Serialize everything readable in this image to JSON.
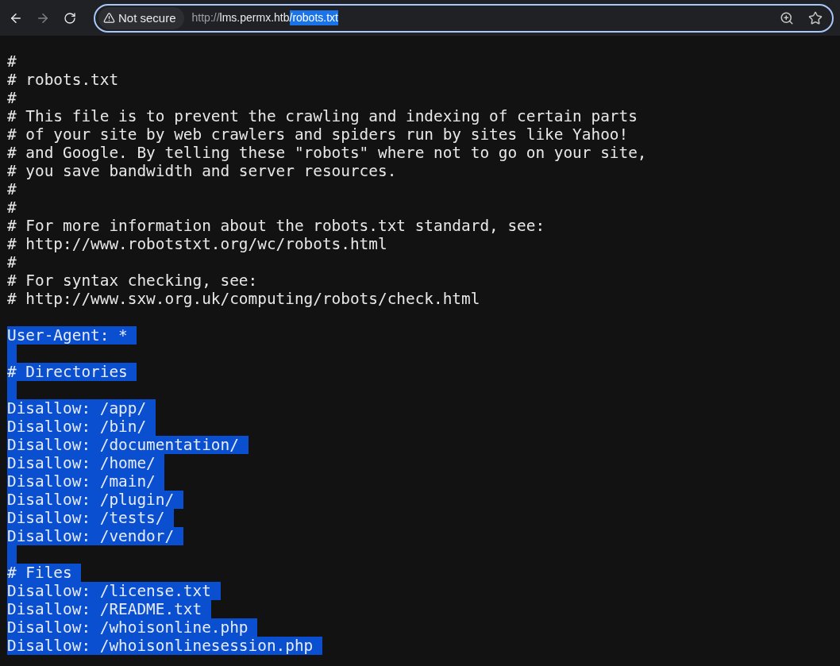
{
  "toolbar": {
    "back_enabled": true,
    "forward_enabled": false
  },
  "address_bar": {
    "security_label": "Not secure",
    "scheme": "http://",
    "host": "lms.permx.htb",
    "path": "/robots.txt",
    "path_selected": true,
    "focused": true
  },
  "document": {
    "lines": [
      {
        "kind": "text",
        "text": "#",
        "selected": false
      },
      {
        "kind": "text",
        "text": "# robots.txt",
        "selected": false
      },
      {
        "kind": "text",
        "text": "#",
        "selected": false
      },
      {
        "kind": "text",
        "text": "# This file is to prevent the crawling and indexing of certain parts",
        "selected": false
      },
      {
        "kind": "text",
        "text": "# of your site by web crawlers and spiders run by sites like Yahoo!",
        "selected": false
      },
      {
        "kind": "text",
        "text": "# and Google. By telling these \"robots\" where not to go on your site,",
        "selected": false
      },
      {
        "kind": "text",
        "text": "# you save bandwidth and server resources.",
        "selected": false
      },
      {
        "kind": "text",
        "text": "#",
        "selected": false
      },
      {
        "kind": "text",
        "text": "#",
        "selected": false
      },
      {
        "kind": "text",
        "text": "# For more information about the robots.txt standard, see:",
        "selected": false
      },
      {
        "kind": "text",
        "text": "# http://www.robotstxt.org/wc/robots.html",
        "selected": false
      },
      {
        "kind": "text",
        "text": "#",
        "selected": false
      },
      {
        "kind": "text",
        "text": "# For syntax checking, see:",
        "selected": false
      },
      {
        "kind": "text",
        "text": "# http://www.sxw.org.uk/computing/robots/check.html",
        "selected": false
      },
      {
        "kind": "blank",
        "selected": false
      },
      {
        "kind": "text",
        "text": "User-Agent: *",
        "selected": true
      },
      {
        "kind": "blank",
        "selected": true
      },
      {
        "kind": "text",
        "text": "# Directories",
        "selected": true
      },
      {
        "kind": "blank",
        "selected": true
      },
      {
        "kind": "text",
        "text": "Disallow: /app/",
        "selected": true
      },
      {
        "kind": "text",
        "text": "Disallow: /bin/",
        "selected": true
      },
      {
        "kind": "text",
        "text": "Disallow: /documentation/",
        "selected": true
      },
      {
        "kind": "text",
        "text": "Disallow: /home/",
        "selected": true
      },
      {
        "kind": "text",
        "text": "Disallow: /main/",
        "selected": true
      },
      {
        "kind": "text",
        "text": "Disallow: /plugin/",
        "selected": true
      },
      {
        "kind": "text",
        "text": "Disallow: /tests/",
        "selected": true
      },
      {
        "kind": "text",
        "text": "Disallow: /vendor/",
        "selected": true
      },
      {
        "kind": "blank",
        "selected": true
      },
      {
        "kind": "text",
        "text": "# Files",
        "selected": true
      },
      {
        "kind": "text",
        "text": "Disallow: /license.txt",
        "selected": true
      },
      {
        "kind": "text",
        "text": "Disallow: /README.txt",
        "selected": true
      },
      {
        "kind": "text",
        "text": "Disallow: /whoisonline.php",
        "selected": true
      },
      {
        "kind": "text",
        "text": "Disallow: /whoisonlinesession.php",
        "selected": true
      }
    ]
  }
}
